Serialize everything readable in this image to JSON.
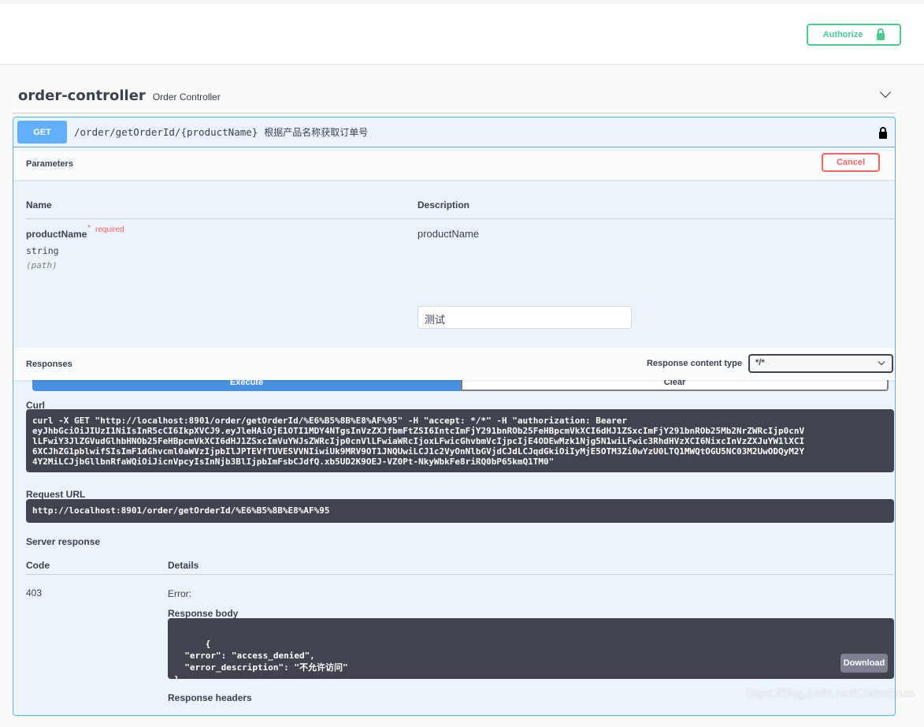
{
  "header": {
    "authorize_label": "Authorize"
  },
  "tag": {
    "name": "order-controller",
    "description": "Order Controller"
  },
  "operation": {
    "method": "GET",
    "path": "/order/getOrderId/{productName}",
    "summary": "根据产品名称获取订单号",
    "parameters_title": "Parameters",
    "cancel_label": "Cancel",
    "col_name": "Name",
    "col_description": "Description",
    "param": {
      "name": "productName",
      "required_mark": "*",
      "required": "required",
      "type": "string",
      "in": "(path)",
      "description": "productName",
      "value": "测试"
    },
    "execute_label": "Execute",
    "clear_label": "Clear",
    "responses_title": "Responses",
    "content_type_label": "Response content type",
    "content_type_value": "*/*",
    "curl_label": "Curl",
    "curl": "curl -X GET \"http://localhost:8901/order/getOrderId/%E6%B5%8B%E8%AF%95\" -H \"accept: */*\" -H \"authorization: Bearer\neyJhbGciOiJIUzI1NiIsInR5cCI6IkpXVCJ9.eyJleHAiOjE1OTI1MDY4NTgsInVzZXJfbmFtZSI6IntcImFjY291bnROb25FeHBpcmVkXCI6dHJ1ZSxcImFjY291bnROb25Mb2NrZWRcIjp0cnV\nlLFwiY3JlZGVudGlhbHNOb25FeHBpcmVkXCI6dHJ1ZSxcImVuYWJsZWRcIjp0cnVlLFwiaWRcIjoxLFwicGhvbmVcIjpcIjE4ODEwMzk1Njg5N1wiLFwic3RhdHVzXCI6NixcInVzZXJuYW1lXCI\n6XCJhZG1pblwifSIsImF1dGhvcml0aWVzIjpbIlJPTEVfTUVESVVNIiwiUk9MRV9OT1JNQUwiLCJ1c2VyOnNlbGVjdCJdLCJqdGkiOiIyMjE5OTM3Zi0wYzU0LTQ1MWQtOGU5NC03M2UwODQyM2Y\n4Y2MiLCJjbGllbnRfaWQiOiJicnVpcyIsInNjb3BlIjpbImFsbCJdfQ.xb5UD2K9OEJ-VZ0Pt-NkyWbkFe8riRQ0bP65kmQ1TM0\"",
    "request_url_label": "Request URL",
    "request_url": "http://localhost:8901/order/getOrderId/%E6%B5%8B%E8%AF%95",
    "server_response_label": "Server response",
    "col_code": "Code",
    "col_details": "Details",
    "status_code": "403",
    "error_label": "Error:",
    "response_body_label": "Response body",
    "response_body": "{\n  \"error\": \"access_denied\",\n  \"error_description\": \"不允许访问\"\n}",
    "download_label": "Download",
    "response_headers_label": "Response headers"
  },
  "watermark": "https://blog.csdn.net/CoderBruis",
  "colors": {
    "get": "#61affe",
    "authorize": "#49cc90",
    "cancel": "#ff6060",
    "execute": "#4990e2",
    "code_bg": "#41444e"
  }
}
